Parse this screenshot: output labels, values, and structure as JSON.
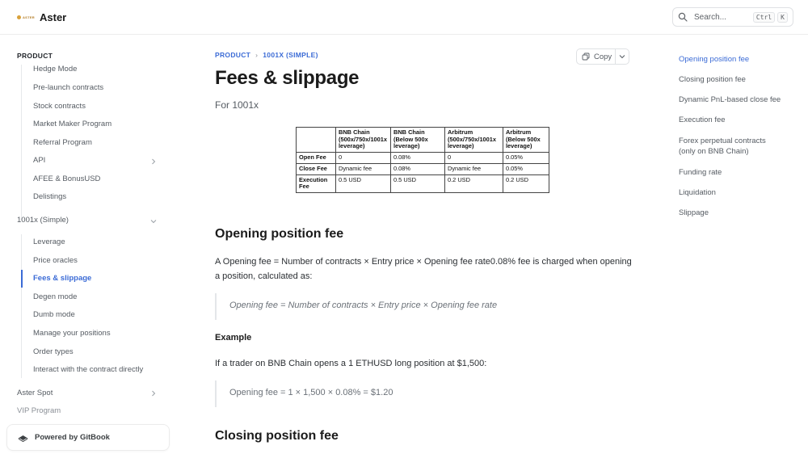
{
  "header": {
    "brand_small": "ASTER",
    "brand": "Aster",
    "search_placeholder": "Search...",
    "kbd_ctrl": "Ctrl",
    "kbd_k": "K"
  },
  "sidebar": {
    "section": "PRODUCT",
    "product_items": [
      "Hedge Mode",
      "Pre-launch contracts",
      "Stock contracts",
      "Market Maker Program",
      "Referral Program",
      "API",
      "AFEE & BonusUSD",
      "Delistings"
    ],
    "group_1001x": "1001x (Simple)",
    "simple_items": [
      "Leverage",
      "Price oracles",
      "Fees & slippage",
      "Degen mode",
      "Dumb mode",
      "Manage your positions",
      "Order types",
      "Interact with the contract directly"
    ],
    "aster_spot": "Aster Spot",
    "vip": "VIP Program",
    "gitbook": "Powered by GitBook"
  },
  "breadcrumb": {
    "parent": "PRODUCT",
    "current": "1001X (SIMPLE)"
  },
  "copy_label": "Copy",
  "page": {
    "title": "Fees & slippage",
    "subtitle": "For 1001x"
  },
  "fee_table": {
    "headers": [
      "",
      "BNB Chain (500x/750x/1001x leverage)",
      "BNB Chain (Below 500x leverage)",
      "Arbitrum (500x/750x/1001x leverage)",
      "Arbitrum (Below 500x leverage)"
    ],
    "rows": [
      [
        "Open Fee",
        "0",
        "0.08%",
        "0",
        "0.05%"
      ],
      [
        "Close Fee",
        "Dynamic fee",
        "0.08%",
        "Dynamic fee",
        "0.05%"
      ],
      [
        "Execution Fee",
        "0.5 USD",
        "0.5 USD",
        "0.2 USD",
        "0.2 USD"
      ]
    ]
  },
  "sections": {
    "opening_title": "Opening position fee",
    "opening_para": "A Opening fee = Number of contracts × Entry price × Opening fee rate0.08% fee is charged when opening a position, calculated as:",
    "opening_formula": "Opening fee = Number of contracts × Entry price × Opening fee rate",
    "example_title": "Example",
    "example_para": "If a trader on BNB Chain opens a 1 ETHUSD long position at $1,500:",
    "example_formula": "Opening fee = 1 × 1,500 × 0.08% = $1.20",
    "closing_title": "Closing position fee"
  },
  "toc": [
    "Opening position fee",
    "Closing position fee",
    "Dynamic PnL-based close fee",
    "Execution fee",
    "Forex perpetual contracts (only on BNB Chain)",
    "Funding rate",
    "Liquidation",
    "Slippage"
  ],
  "colors": {
    "accent": "#3b6bd6",
    "brand": "#d9a13b"
  },
  "icons": [
    "search-icon",
    "chevron-right-icon",
    "chevron-down-icon",
    "copy-icon",
    "gitbook-icon"
  ]
}
